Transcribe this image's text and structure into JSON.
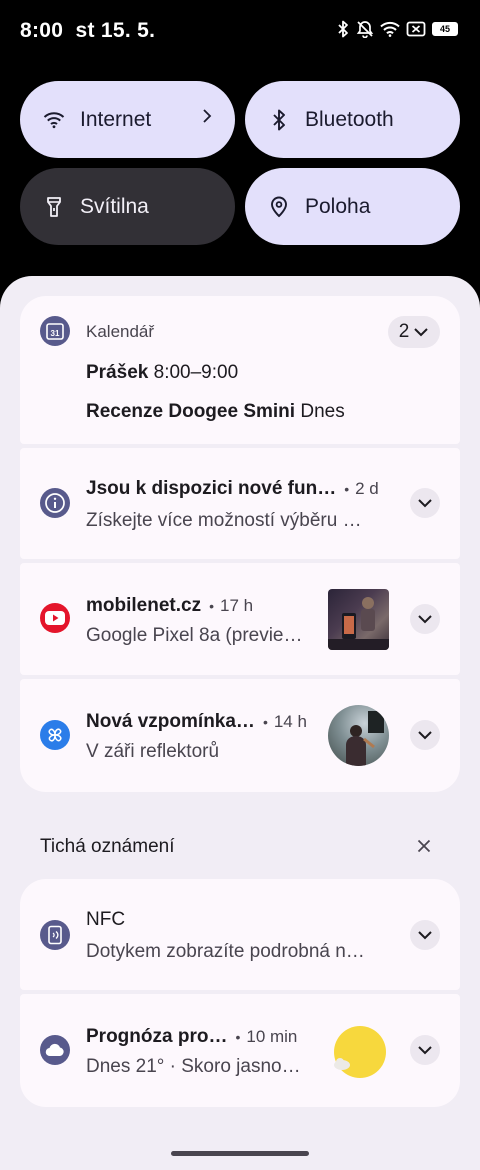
{
  "status": {
    "time": "8:00",
    "date": "st 15. 5.",
    "battery": "45"
  },
  "tiles": {
    "internet": "Internet",
    "bluetooth": "Bluetooth",
    "flashlight": "Svítilna",
    "location": "Poloha"
  },
  "notifications": {
    "calendar": {
      "app": "Kalendář",
      "count": "2",
      "event1_title": "Prášek",
      "event1_time": "8:00–9:00",
      "event2_title": "Recenze Doogee Smini",
      "event2_time": "Dnes",
      "icon_text": "31"
    },
    "features": {
      "title": "Jsou k dispozici nové fun…",
      "time": "2 d",
      "body": "Získejte více možností výběru …"
    },
    "youtube": {
      "title": "mobilenet.cz",
      "time": "17 h",
      "body": "Google Pixel 8a (previe…"
    },
    "memory": {
      "title": "Nová vzpomínka…",
      "time": "14 h",
      "body": "V záři reflektorů"
    }
  },
  "silent": {
    "header": "Tichá oznámení",
    "nfc": {
      "title": "NFC",
      "body": "Dotykem zobrazíte podrobná n…"
    },
    "weather": {
      "title": "Prognóza pro…",
      "time": "10 min",
      "body": "Dnes 21° · Skoro jasno…"
    }
  },
  "colors": {
    "tile_active": "#e3e0fb",
    "tile_inactive": "#323036",
    "panel_bg": "#f1edf5",
    "card_bg": "#fdf8fd",
    "app_icon_purple": "#585a8c",
    "youtube_red": "#e4152b",
    "photos_blue": "#2b7de9",
    "weather_sun": "#f7d83d"
  }
}
